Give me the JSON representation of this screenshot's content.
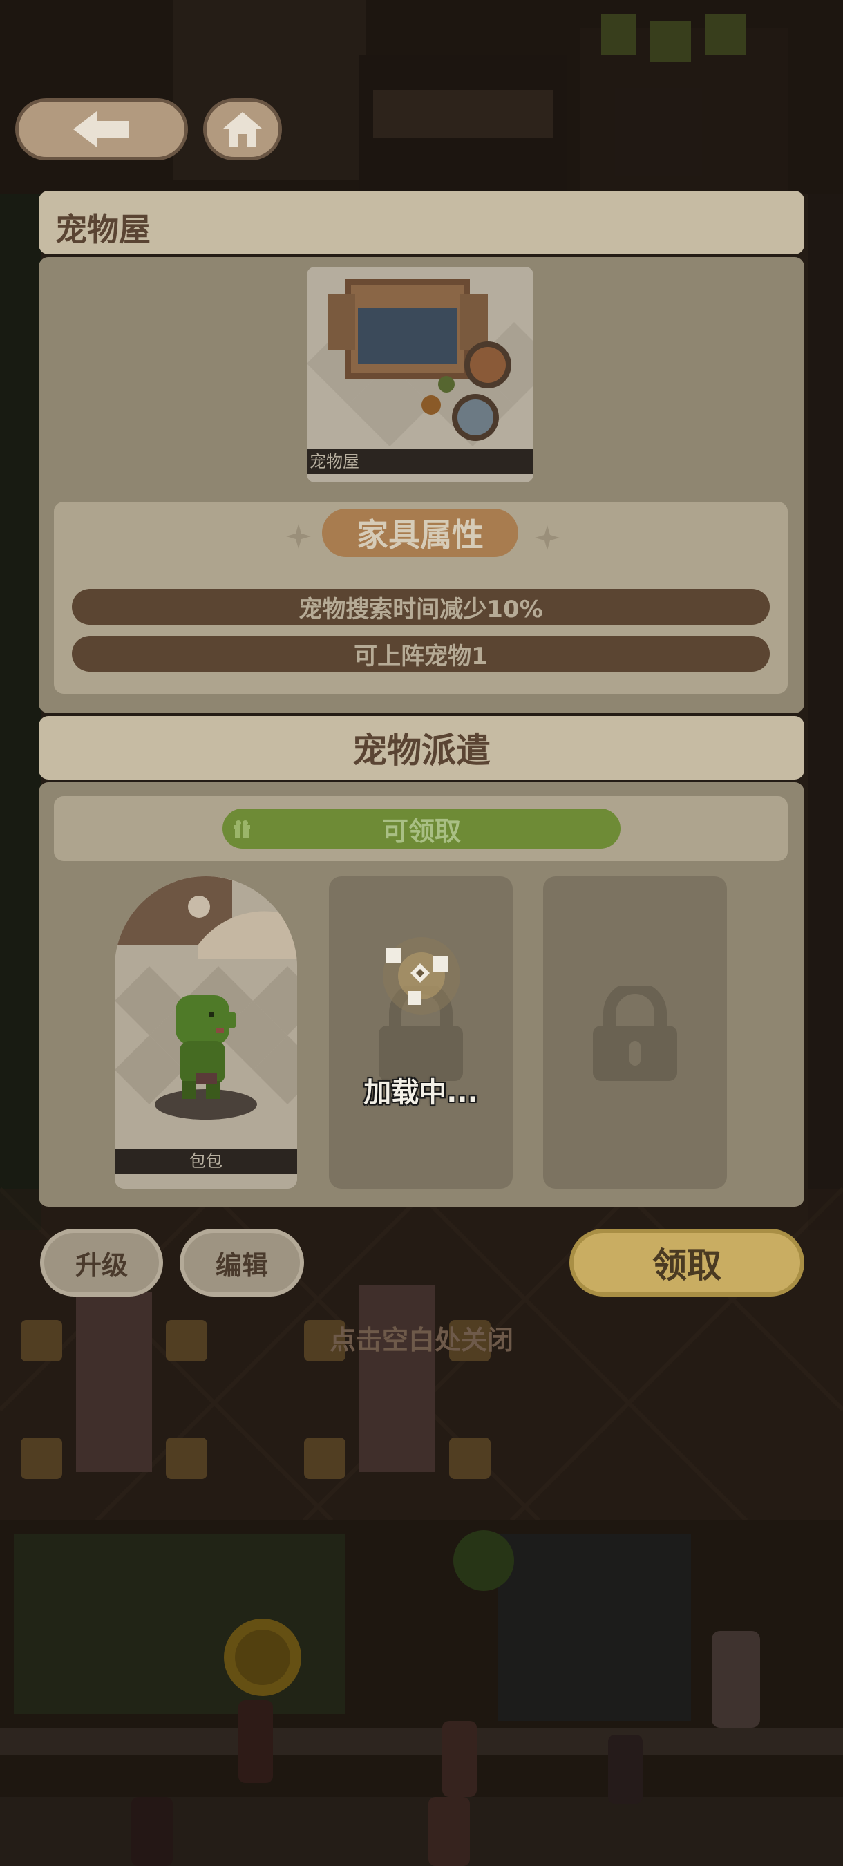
{
  "header": {
    "back_icon": "arrow-left-icon",
    "home_icon": "home-icon"
  },
  "furniture": {
    "title": "宠物屋",
    "item_name": "宠物屋"
  },
  "attributes": {
    "heading": "家具属性",
    "rows": [
      "宠物搜索时间减少10%",
      "可上阵宠物1"
    ]
  },
  "dispatch": {
    "heading": "宠物派遣",
    "status_label": "可领取",
    "status_icon": "gift-icon",
    "pet_name": "包包",
    "loading_text": "加载中...",
    "locked_icon": "lock-icon"
  },
  "actions": {
    "upgrade_label": "升级",
    "edit_label": "编辑",
    "claim_label": "领取"
  },
  "hint": "点击空白处关闭",
  "colors": {
    "accent_gold": "#c9ad62",
    "status_green": "#6e8b36",
    "heading_orange": "#a87c4f",
    "panel_brown": "#5b4532"
  }
}
